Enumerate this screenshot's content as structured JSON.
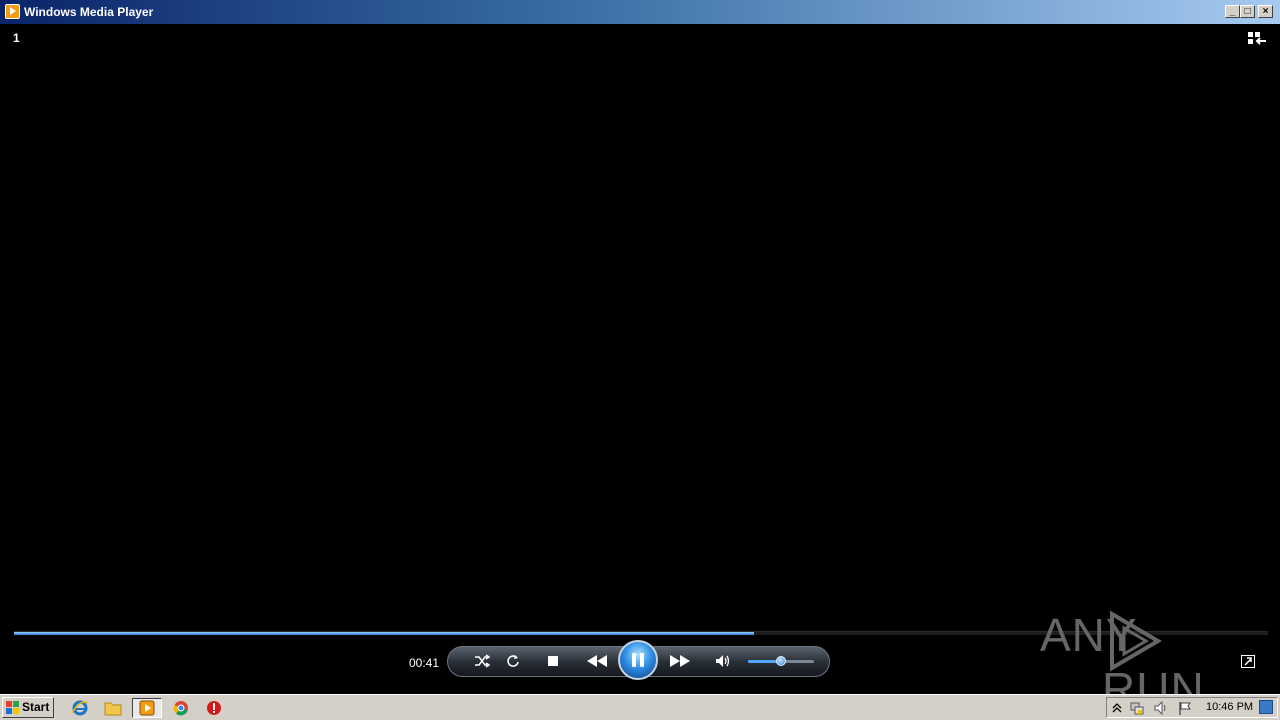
{
  "window": {
    "title": "Windows Media Player"
  },
  "titlebar_buttons": {
    "minimize": "_",
    "maximize": "□",
    "close": "×"
  },
  "player": {
    "track_number": "1",
    "elapsed_time": "00:41",
    "seek_progress": 0.59,
    "volume_level": 0.5,
    "state": "playing"
  },
  "controls": {
    "shuffle_icon": "shuffle-icon",
    "repeat_icon": "repeat-icon",
    "stop_icon": "stop-icon",
    "previous_icon": "previous-icon",
    "pause_icon": "pause-icon",
    "next_icon": "next-icon",
    "mute_icon": "speaker-icon"
  },
  "watermark": {
    "text_left": "ANY",
    "text_right": "RUN"
  },
  "taskbar": {
    "start_label": "Start",
    "apps": [
      "internet-explorer-icon",
      "folder-icon",
      "media-player-icon",
      "chrome-icon",
      "stop-sign-icon"
    ],
    "clock": "10:46 PM"
  },
  "colors": {
    "accent": "#2a78d6",
    "title_start": "#0a246a",
    "title_end": "#a6caf0",
    "taskbar": "#d4d0c8"
  }
}
